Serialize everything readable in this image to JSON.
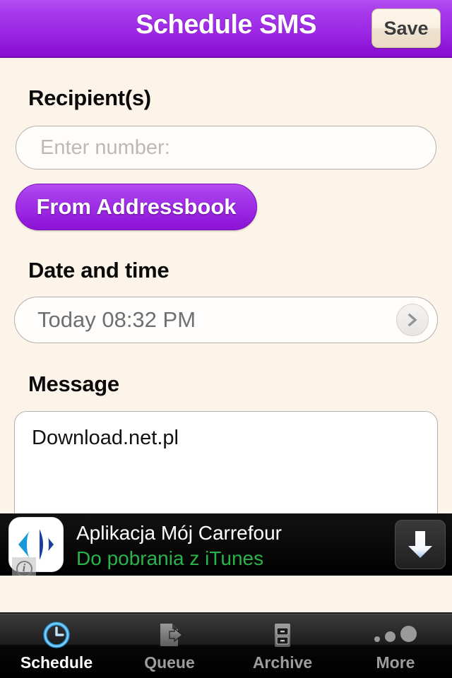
{
  "header": {
    "title": "Schedule SMS",
    "save_label": "Save",
    "gradient_top": "#b44ef0",
    "gradient_bottom": "#8a10d2"
  },
  "form": {
    "recipients_label": "Recipient(s)",
    "recipient_placeholder": "Enter number:",
    "recipient_value": "",
    "addressbook_label": "From Addressbook",
    "datetime_label": "Date and time",
    "datetime_value": "Today 08:32 PM",
    "datetime_chevron": "chevron-right-icon",
    "message_label": "Message",
    "message_value": "Download.net.pl"
  },
  "ad": {
    "title": "Aplikacja Mój Carrefour",
    "subtitle": "Do pobrania z iTunes",
    "subtitle_color": "#2ab34a",
    "logo_name": "carrefour-logo",
    "info_badge": "i",
    "download_icon": "download-arrow-icon"
  },
  "tabbar": {
    "items": [
      {
        "label": "Schedule",
        "icon": "clock-icon",
        "active": true
      },
      {
        "label": "Queue",
        "icon": "document-arrow-icon",
        "active": false
      },
      {
        "label": "Archive",
        "icon": "file-cabinet-icon",
        "active": false
      },
      {
        "label": "More",
        "icon": "ellipsis-icon",
        "active": false
      }
    ],
    "active_color": "#ffffff",
    "inactive_color": "#9d9d9d",
    "accent_color": "#3aa7e8"
  },
  "theme": {
    "background": "#fdf4e9",
    "accent": "#9a25e3"
  }
}
